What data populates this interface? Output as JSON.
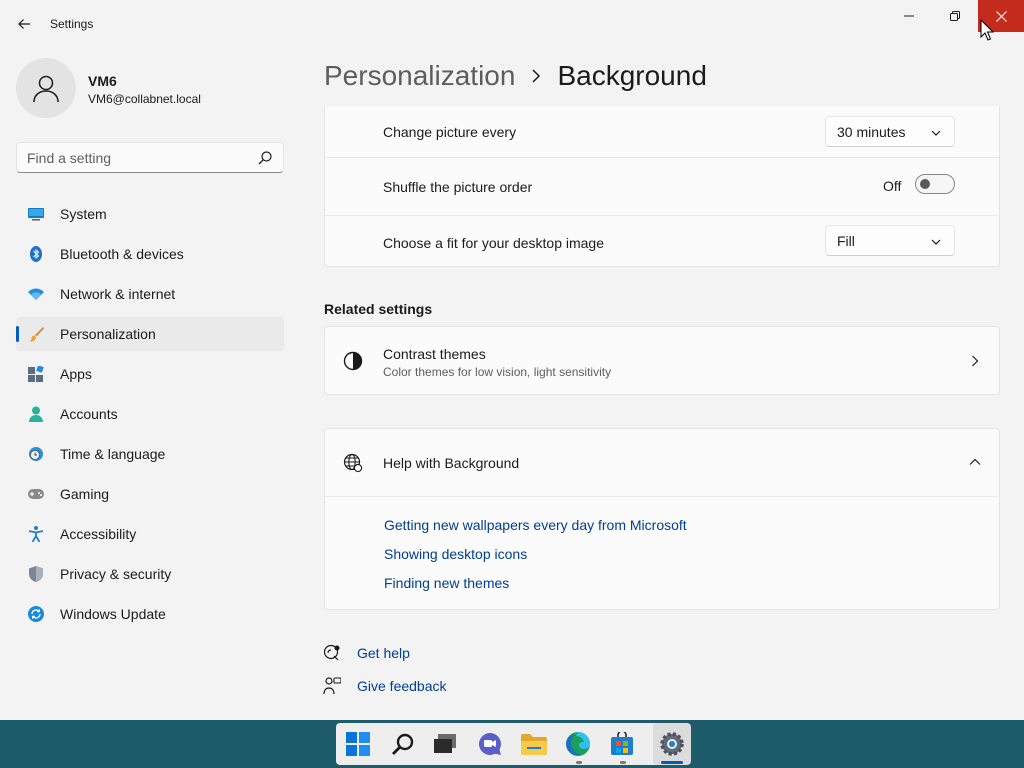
{
  "window": {
    "title": "Settings"
  },
  "profile": {
    "name": "VM6",
    "email": "VM6@collabnet.local"
  },
  "search": {
    "placeholder": "Find a setting"
  },
  "nav": {
    "items": [
      {
        "label": "System",
        "icon": "monitor-icon"
      },
      {
        "label": "Bluetooth & devices",
        "icon": "bluetooth-icon"
      },
      {
        "label": "Network & internet",
        "icon": "wifi-icon"
      },
      {
        "label": "Personalization",
        "icon": "paintbrush-icon",
        "active": true
      },
      {
        "label": "Apps",
        "icon": "apps-icon"
      },
      {
        "label": "Accounts",
        "icon": "person-icon"
      },
      {
        "label": "Time & language",
        "icon": "globe-clock-icon"
      },
      {
        "label": "Gaming",
        "icon": "gamepad-icon"
      },
      {
        "label": "Accessibility",
        "icon": "accessibility-icon"
      },
      {
        "label": "Privacy & security",
        "icon": "shield-icon"
      },
      {
        "label": "Windows Update",
        "icon": "update-icon"
      }
    ]
  },
  "header": {
    "parent": "Personalization",
    "current": "Background"
  },
  "background_settings": {
    "change_picture": {
      "label": "Change picture every",
      "value": "30 minutes"
    },
    "shuffle": {
      "label": "Shuffle the picture order",
      "state": "Off"
    },
    "fit": {
      "label": "Choose a fit for your desktop image",
      "value": "Fill"
    }
  },
  "related": {
    "heading": "Related settings",
    "contrast": {
      "title": "Contrast themes",
      "subtitle": "Color themes for low vision, light sensitivity"
    }
  },
  "help": {
    "title": "Help with Background",
    "links": [
      "Getting new wallpapers every day from Microsoft",
      "Showing desktop icons",
      "Finding new themes"
    ]
  },
  "footer": {
    "get_help": "Get help",
    "give_feedback": "Give feedback"
  },
  "colors": {
    "accent": "#005fb8",
    "link": "#003e92",
    "close_hover": "#c42b1c",
    "taskbar": "#1d5d6b"
  },
  "taskbar": {
    "apps": [
      "windows-start-icon",
      "search-icon",
      "task-view-icon",
      "chat-icon",
      "file-explorer-icon",
      "edge-icon",
      "store-icon",
      "settings-icon"
    ]
  }
}
